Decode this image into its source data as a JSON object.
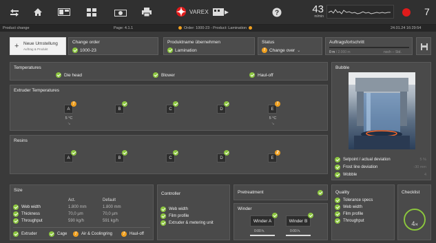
{
  "toolbar": {
    "brand": "VAREX",
    "speed_value": "43",
    "speed_unit": "m/min",
    "counter": "7"
  },
  "strip": {
    "left": "Product change",
    "page": "Page: 4.1.1",
    "order": "Order: 1000-23 - Product: Lamination",
    "datetime": "24.01.24  16:29:54"
  },
  "header": {
    "new_change_label": "Neue Umstellung",
    "new_change_sub": "Auftrag & Produkt",
    "change_order_label": "Change order",
    "change_order_value": "1000-23",
    "product_label": "Produktname übernehmen",
    "product_value": "Lamination",
    "status_label": "Status",
    "status_value": "Change over",
    "progress_label": "Auftragsfortschritt",
    "progress_done": "0 m",
    "progress_total": "/ 2.000 m",
    "progress_remaining": "noch -- Std."
  },
  "temperatures": {
    "title": "Temperatures",
    "items": [
      "Die head",
      "Blower",
      "Haul-off"
    ]
  },
  "extruder": {
    "title": "Extruder Temperatures",
    "units": [
      {
        "id": "A",
        "state": "warn",
        "temp": "5 °C",
        "arrow": "↘"
      },
      {
        "id": "B",
        "state": "ok",
        "temp": "",
        "arrow": ""
      },
      {
        "id": "C",
        "state": "ok",
        "temp": "",
        "arrow": ""
      },
      {
        "id": "D",
        "state": "ok",
        "temp": "",
        "arrow": ""
      },
      {
        "id": "E",
        "state": "warn",
        "temp": "5 °C",
        "arrow": "↘"
      }
    ]
  },
  "resins": {
    "title": "Resins",
    "units": [
      {
        "id": "A",
        "state": "ok"
      },
      {
        "id": "B",
        "state": "ok"
      },
      {
        "id": "C",
        "state": "ok"
      },
      {
        "id": "D",
        "state": "ok"
      },
      {
        "id": "E",
        "state": "warn",
        "badge": "2"
      }
    ]
  },
  "bubble": {
    "title": "Bubble",
    "rows": [
      {
        "label": "Setpoint / actual deviation",
        "value": "5 %"
      },
      {
        "label": "Frost line deviation",
        "value": "-30 mm"
      },
      {
        "label": "Wobble",
        "value": "4"
      }
    ]
  },
  "size": {
    "title": "Size",
    "col_act": "Act.",
    "col_default": "Default",
    "rows": [
      {
        "label": "Web width",
        "act": "1.800 mm",
        "def": "1.800 mm"
      },
      {
        "label": "Thickness",
        "act": "70,0 µm",
        "def": "70,0 µm"
      },
      {
        "label": "Throughput",
        "act": "590 kg/h",
        "def": "591 kg/h"
      }
    ],
    "footer": [
      {
        "label": "Extruder",
        "state": "ok"
      },
      {
        "label": "Cage",
        "state": "ok"
      },
      {
        "label": "Air & Coolingring",
        "state": "warn"
      },
      {
        "label": "Haul-off",
        "state": "warn"
      }
    ]
  },
  "controller": {
    "title": "Controller",
    "items": [
      "Web width",
      "Film profile",
      "Extruder & metering unit"
    ]
  },
  "pretreatment": {
    "title": "Pretreatment"
  },
  "winder": {
    "title": "Winder",
    "a_label": "Winder A",
    "b_label": "Winder B",
    "a_hours": "0:00 h.",
    "b_hours": "0:00 h."
  },
  "quality": {
    "title": "Quality",
    "items": [
      "Tolerance specs",
      "Web width",
      "Film profile",
      "Throughput"
    ]
  },
  "checklist": {
    "title": "Checklist",
    "done": 4,
    "total": 4,
    "done_label": "4",
    "total_label": "/4"
  },
  "colors": {
    "ok": "#8cc63f",
    "warn": "#f0a020",
    "alert": "#e01b1b",
    "panel": "#4a4a4a"
  }
}
